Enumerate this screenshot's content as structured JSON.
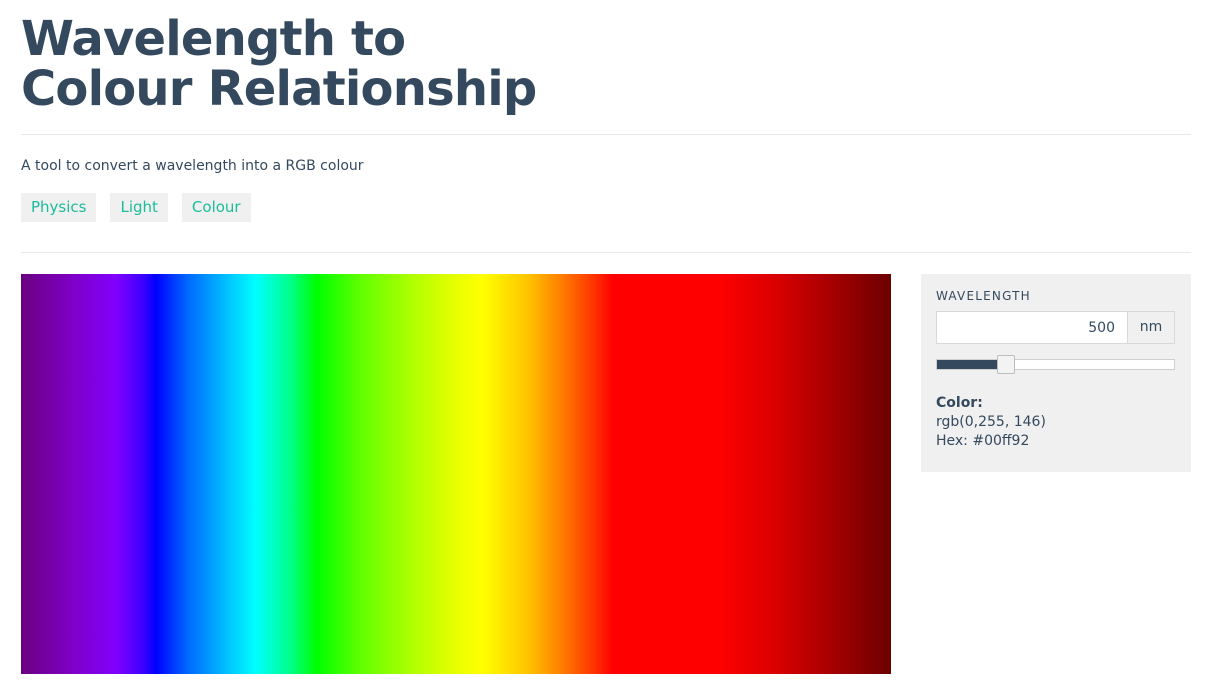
{
  "header": {
    "title": "Wavelength to Colour Relationship"
  },
  "description": "A tool to convert a wavelength into a RGB colour",
  "tags": [
    "Physics",
    "Light",
    "Colour"
  ],
  "wavelength_panel": {
    "label": "WAVELENGTH",
    "value": "500",
    "unit": "nm",
    "slider_fraction": 0.29
  },
  "color": {
    "heading": "Color:",
    "rgb": "rgb(0,255, 146)",
    "hex": "Hex: #00ff92"
  },
  "colors": {
    "text": "#34495e",
    "accent": "#1abc9c",
    "panel_bg": "#f0f0f0"
  }
}
